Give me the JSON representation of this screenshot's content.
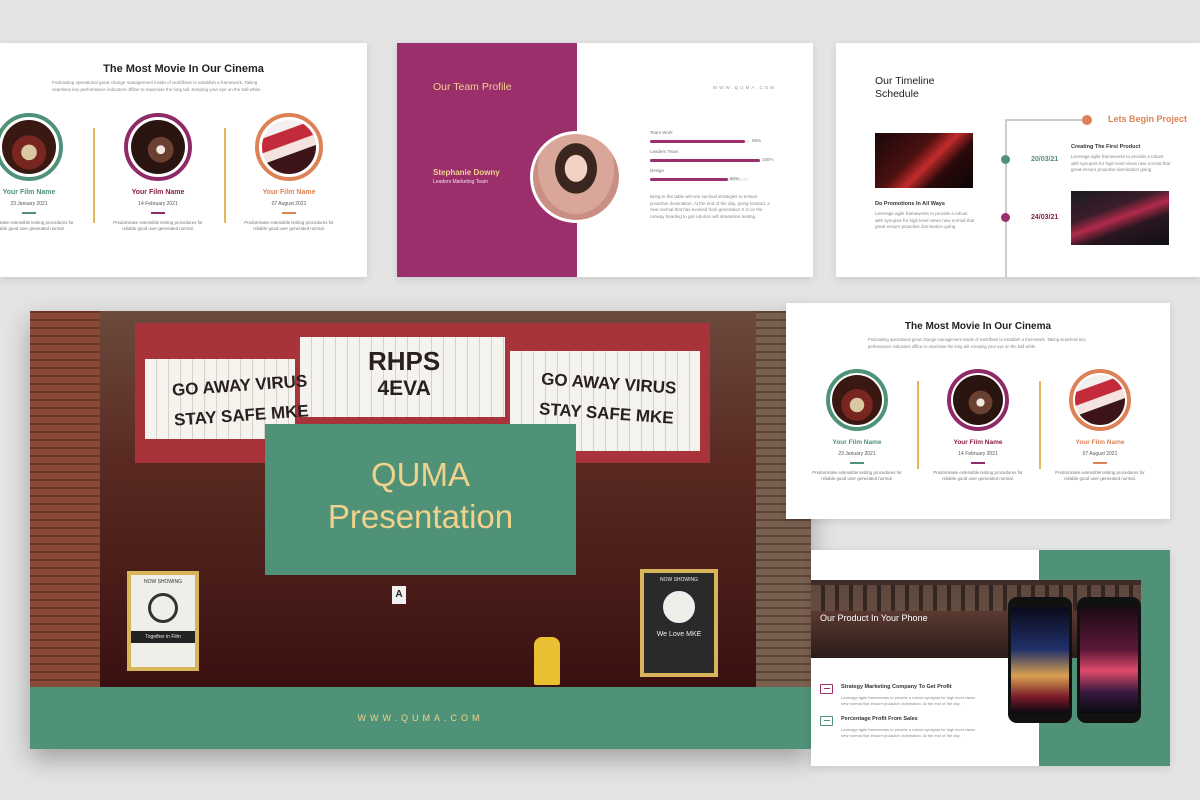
{
  "colors": {
    "green": "#4f9278",
    "plum": "#9b2f6c",
    "orange": "#dd8256",
    "gold": "#f0d28c",
    "maroon": "#8a1f3d"
  },
  "movie_slide": {
    "title": "The Most Movie In Our Cinema",
    "subtitle": "Podcasting operational great change management inside of workflows to establish a framework. Taking seamless key performance indicators offline to maximise the long tail. Keeping your eye on the ball while.",
    "films": [
      {
        "name": "Your Film Name",
        "date": "23 January 2021",
        "desc": "Predominate extensible testing procedures for reliable good user generated normal."
      },
      {
        "name": "Your Film Name",
        "date": "14 February 2021",
        "desc": "Predominate extensible testing procedures for reliable good user generated normal."
      },
      {
        "name": "Your Film Name",
        "date": "07 August 2021",
        "desc": "Predominate extensible testing procedures for reliable good user generated normal."
      }
    ]
  },
  "team_slide": {
    "title": "Our Team Profile",
    "website": "WWW.QUMA.COM",
    "person_name": "Stephanie Downy",
    "person_role": "Leaders Marketing Team",
    "skills": [
      {
        "label": "Team Work",
        "percent_text": "95%",
        "value": 0.95
      },
      {
        "label": "Leaders Team",
        "percent_text": "100%",
        "value": 1.0
      },
      {
        "label": "Design",
        "percent_text": "80%",
        "value": 0.8
      }
    ],
    "paragraph": "Bring to the table win-win survival strategies to ensure proactive domination. At the end of the day, going forward, a new normal that has evolved from generation X is on the runway heading to get solution will streamline testing."
  },
  "timeline_slide": {
    "title_line1": "Our Timeline",
    "title_line2": "Schedule",
    "start_label": "Lets Begin Project",
    "date1": "20/03/21",
    "date2": "24/03/21",
    "item_right_title": "Creating The First Product",
    "item_right_desc": "Leverage agile frameworks to provide a robust with synopsis for high level views new normal that great ensure proactive domination going",
    "item_left_title": "Do Promotions In All Ways",
    "item_left_desc": "Leverage agile frameworks to provide a robust with synopsis for high level views new normal that great ensure proactive domination going"
  },
  "main_slide": {
    "title_line1": "QUMA",
    "title_line2": "Presentation",
    "website": "WWW.QUMA.COM",
    "marquee_center_line1": "RHPS",
    "marquee_center_line2": "4EVA",
    "marquee_left_line1": "GO AWAY VIRUS",
    "marquee_left_line2": "STAY SAFE MKE",
    "marquee_right_line1": "GO AWAY VIRUS",
    "marquee_right_line2": "STAY SAFE MKE",
    "poster_left_top": "NOW SHOWING",
    "poster_left_bottom": "Together in Film",
    "poster_right_top": "NOW SHOWING",
    "poster_right_bottom": "We Love MKE",
    "door_sign": "A"
  },
  "phone_slide": {
    "title": "Our Product In Your Phone",
    "features": [
      {
        "title": "Strategy Marketing Company To Get Profit",
        "desc": "Leverage agile frameworks to provide a robust synopsis for high level views new normal that ensure proactive domination. At the end of the day."
      },
      {
        "title": "Percentage Profit From Sales",
        "desc": "Leverage agile frameworks to provide a robust synopsis for high level views new normal that ensure proactive domination. At the end of the day."
      }
    ]
  }
}
